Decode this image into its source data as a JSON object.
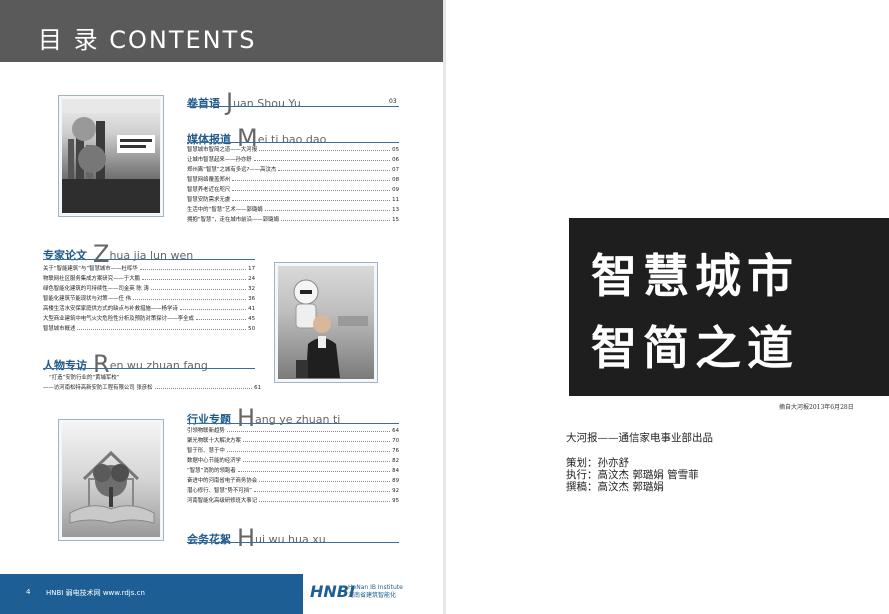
{
  "header": {
    "title": "目 录 CONTENTS"
  },
  "sections": {
    "juanshouyu": {
      "zh": "卷首语",
      "initial": "J",
      "rest": "uan Shou Yu",
      "page": "03"
    },
    "meiti": {
      "zh": "媒体报道",
      "initial": "M",
      "rest": "ei ti bao dao"
    },
    "zhuanjia": {
      "zh": "专家论文",
      "initial": "Z",
      "rest": "hua jia lun wen"
    },
    "renwu": {
      "zh": "人物专访",
      "initial": "R",
      "rest": "en wu zhuan fang"
    },
    "hangye": {
      "zh": "行业专题",
      "initial": "H",
      "rest": "ang ye zhuan ti"
    },
    "huaxu": {
      "zh": "会务花絮",
      "initial": "H",
      "rest": "ui wu hua xu"
    }
  },
  "meiti_items": [
    {
      "text": "智慧城市智简之道——大河报",
      "page": "05"
    },
    {
      "text": "让城市智慧起来——孙亦舒",
      "page": "06"
    },
    {
      "text": "郑州离“智慧”之城有多远?——高汶杰",
      "page": "07"
    },
    {
      "text": "智慧网络覆盖郑州",
      "page": "08"
    },
    {
      "text": "智慧养老近在咫尺",
      "page": "09"
    },
    {
      "text": "智慧安防需求无虞",
      "page": "11"
    },
    {
      "text": "生活中的“智慧”艺术——郭璐娟",
      "page": "13"
    },
    {
      "text": "拥抱“智慧”，走在城市前沿——郭璐娟",
      "page": "15"
    }
  ],
  "zhuanjia_items": [
    {
      "text": "关于“智能建筑”与“智慧城市——杜晖华",
      "page": "17"
    },
    {
      "text": "物联网社区服务集成方案研究——于大鹏",
      "page": "24"
    },
    {
      "text": "绿色智能化建筑的可持续性——司金英  陈  涛",
      "page": "32"
    },
    {
      "text": "智能化建筑节能现状与对策——任  伟",
      "page": "36"
    },
    {
      "text": "高楼生活水安保家庭供方式的缺点与补救措施——杨学诗",
      "page": "41"
    },
    {
      "text": "大型商业建筑中电气火灾危险性分析及预防对策探讨——李全成",
      "page": "45"
    },
    {
      "text": "智慧城市概述",
      "page": "50"
    }
  ],
  "renwu_item": {
    "line1": "“打造”安防行业的“黄埔军校”",
    "line2": "——访河南松特高新安防工程有限公司  张彦松",
    "page": "61"
  },
  "hangye_items": [
    {
      "text": "引领物联新趋势",
      "page": "64"
    },
    {
      "text": "聚光物联十大解决方案",
      "page": "70"
    },
    {
      "text": "智于形、慧于中",
      "page": "76"
    },
    {
      "text": "数据中心节能的经济学",
      "page": "82"
    },
    {
      "text": "“智慧”消防的领跑者",
      "page": "84"
    },
    {
      "text": "奋进中的河南省电子商务协会",
      "page": "89"
    },
    {
      "text": "潜心修行、智慧“势不可挡”",
      "page": "92"
    },
    {
      "text": "河南智能化高级研修班大事记",
      "page": "95"
    }
  ],
  "footer": {
    "page_num": "4",
    "site": "HNBI 弱电技术网 www.rdjs.cn",
    "logo": "HNBI",
    "org_en": "HeNan IB Institute",
    "org_zh": "河南省建筑智能化"
  },
  "right": {
    "title_line1": "智慧城市",
    "title_line2": "智简之道",
    "source": "摘自大河报2013年6月28日",
    "publisher": "大河报——通信家电事业部出品",
    "planner": "策划：孙亦舒",
    "executor": "执行：高汶杰  郭璐娟  管雪菲",
    "writer": "撰稿：高汶杰  郭璐娟"
  },
  "colors": {
    "header_bg": "#5a5a5a",
    "accent_blue": "#1d5f95",
    "rule_blue": "#3a6c9a"
  }
}
